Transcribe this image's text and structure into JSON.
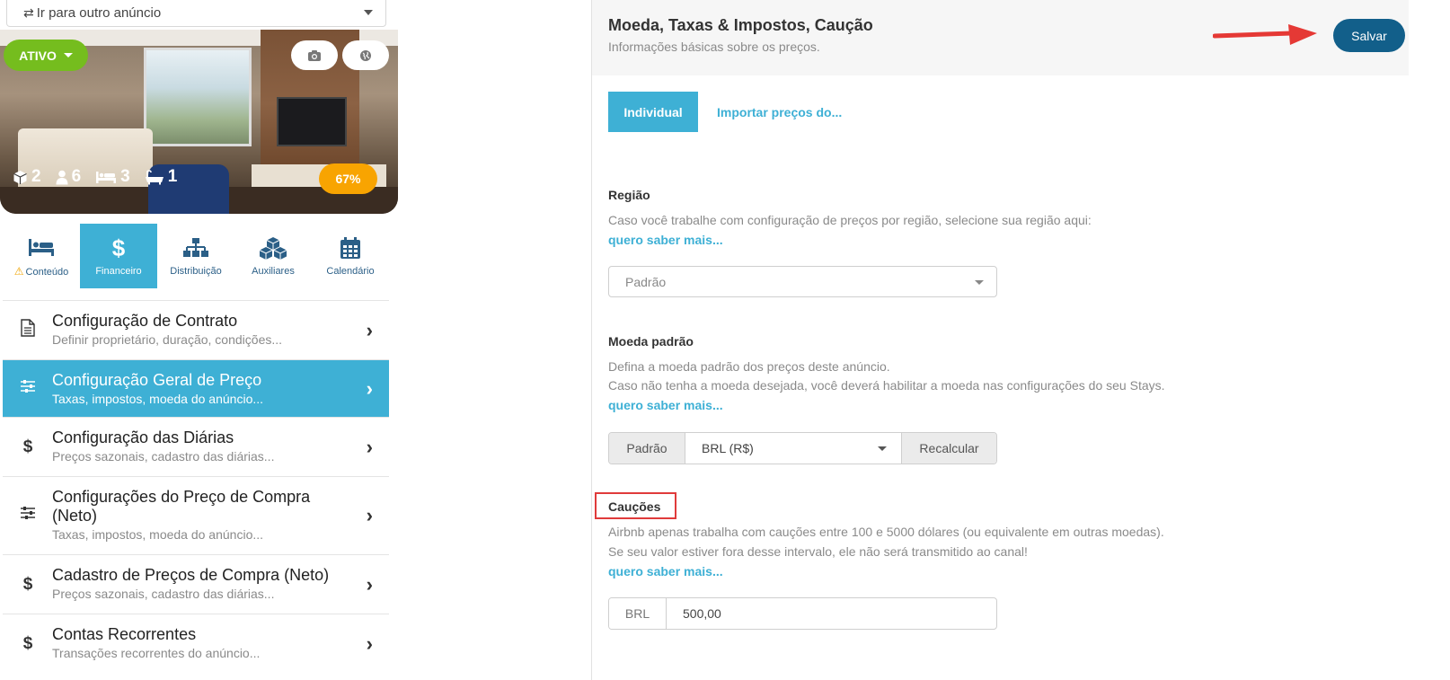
{
  "listing_switcher": {
    "icon": "swap-icon",
    "label": "Ir para outro anúncio"
  },
  "listing": {
    "status_label": "ATIVO",
    "stats": {
      "rooms": "2",
      "guests": "6",
      "beds": "3",
      "baths": "1"
    },
    "completion": "67%"
  },
  "tabs": [
    {
      "label": "Conteúdo",
      "warning": true
    },
    {
      "label": "Financeiro",
      "active": true
    },
    {
      "label": "Distribuição"
    },
    {
      "label": "Auxiliares"
    },
    {
      "label": "Calendário"
    }
  ],
  "menu": [
    {
      "title": "Configuração de Contrato",
      "subtitle": "Definir proprietário, duração, condições..."
    },
    {
      "title": "Configuração Geral de Preço",
      "subtitle": "Taxas, impostos, moeda do anúncio...",
      "active": true
    },
    {
      "title": "Configuração das Diárias",
      "subtitle": "Preços sazonais, cadastro das diárias..."
    },
    {
      "title": "Configurações do Preço de Compra",
      "title2": "(Neto)",
      "subtitle": "Taxas, impostos, moeda do anúncio..."
    },
    {
      "title": "Cadastro de Preços de Compra (Neto)",
      "subtitle": "Preços sazonais, cadastro das diárias..."
    },
    {
      "title": "Contas Recorrentes",
      "subtitle": "Transações recorrentes do anúncio..."
    }
  ],
  "header": {
    "title": "Moeda, Taxas & Impostos, Caução",
    "subtitle": "Informações básicas sobre os preços.",
    "save_label": "Salvar"
  },
  "mode_tabs": {
    "individual": "Individual",
    "import": "Importar preços do..."
  },
  "region": {
    "label": "Região",
    "description": "Caso você trabalhe com configuração de preços por região, selecione sua região aqui:",
    "more": "quero saber mais...",
    "selected": "Padrão"
  },
  "currency": {
    "label": "Moeda padrão",
    "description1": "Defina a moeda padrão dos preços deste anúncio.",
    "description2": "Caso não tenha a moeda desejada, você deverá habilitar a moeda nas configurações do seu Stays.",
    "more": "quero saber mais...",
    "prefix": "Padrão",
    "selected": "BRL (R$)",
    "recalc_label": "Recalcular"
  },
  "deposit": {
    "label": "Cauções",
    "description1": "Airbnb apenas trabalha com cauções entre 100 e 5000 dólares (ou equivalente em outras moedas).",
    "description2": "Se seu valor estiver fora desse intervalo, ele não será transmitido ao canal!",
    "more": "quero saber mais...",
    "currency": "BRL",
    "value": "500,00"
  },
  "colors": {
    "accent": "#3eb0d5",
    "save": "#125f8a",
    "active_badge": "#75bd1e",
    "completion": "#f8a401",
    "highlight": "#e03b3b"
  }
}
